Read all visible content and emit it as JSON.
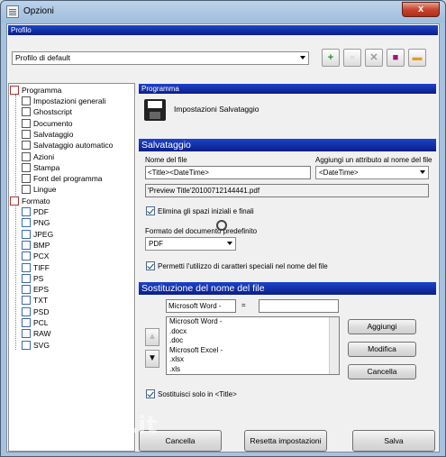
{
  "window": {
    "title": "Opzioni",
    "close_glyph": "x"
  },
  "profile": {
    "header": "Profilo",
    "selected": "Profilo di default",
    "toolbar_icons": [
      "add-icon",
      "rename-icon",
      "delete-icon",
      "save-icon",
      "folder-icon"
    ]
  },
  "tree": {
    "programma": "Programma",
    "programma_items": [
      "Impostazioni generali",
      "Ghostscript",
      "Documento",
      "Salvataggio",
      "Salvataggio automatico",
      "Azioni",
      "Stampa",
      "Font del programma",
      "Lingue"
    ],
    "formato": "Formato",
    "formato_items": [
      "PDF",
      "PNG",
      "JPEG",
      "BMP",
      "PCX",
      "TIFF",
      "PS",
      "EPS",
      "TXT",
      "PSD",
      "PCL",
      "RAW",
      "SVG"
    ]
  },
  "main": {
    "section_programma": "Programma",
    "section_title": "Impostazioni Salvataggio",
    "salvataggio_header": "Salvataggio",
    "filename_label": "Nome del file",
    "filename_value": "<Title><DateTime>",
    "attribute_label": "Aggiungi un attributo al nome del file",
    "attribute_value": "<DateTime>",
    "preview_value": "'Preview Title'20100712144441.pdf",
    "trim_label": "Elimina gli spazi iniziali e finali",
    "default_format_label": "Formato del documento predefinito",
    "default_format_value": "PDF",
    "special_chars_label": "Permetti l'utilizzo di caratteri speciali nel nome del file",
    "sostituzione_header": "Sostituzione del nome del file",
    "replace_from": "Microsoft Word -",
    "equals": "=",
    "replace_to": "",
    "replace_list": [
      "Microsoft Word -",
      ".docx",
      ".doc",
      "Microsoft Excel -",
      ".xlsx",
      ".xls"
    ],
    "add_button": "Aggiungi",
    "modify_button": "Modifica",
    "cancel_item_button": "Cancella",
    "only_title_label": "Sostituisci solo in <Title>"
  },
  "footer": {
    "cancel": "Cancella",
    "reset": "Resetta impostazioni",
    "save": "Salva"
  },
  "watermark": "MegaLab.it"
}
